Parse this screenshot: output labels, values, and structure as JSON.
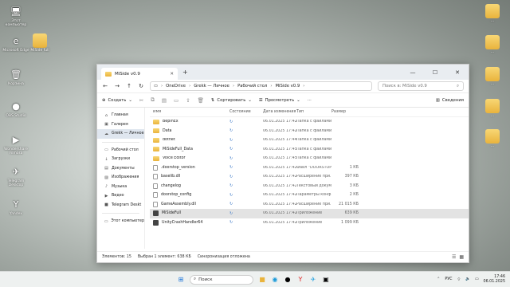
{
  "desktop": {
    "icons_left": [
      {
        "label": "Этот компьютер",
        "glyph": "🖥"
      },
      {
        "label": "Microsoft Edge",
        "glyph": "e"
      },
      {
        "label": "MiSide full",
        "glyph": ""
      },
      {
        "label": "Корзина",
        "glyph": "🗑"
      },
      {
        "label": "OBS Studio",
        "glyph": "●"
      },
      {
        "label": "Wondershare Filmora",
        "glyph": "▶"
      },
      {
        "label": "Telegram Desktop",
        "glyph": "✈"
      },
      {
        "label": "Yandex",
        "glyph": "Y"
      }
    ],
    "icons_right": [
      {
        "label": "..."
      },
      {
        "label": "..."
      },
      {
        "label": "..."
      },
      {
        "label": "..."
      },
      {
        "label": "..."
      }
    ]
  },
  "window": {
    "tab_title": "MiSide v0.9",
    "new_tab": "+",
    "controls": {
      "minimize": "—",
      "maximize": "☐",
      "close": "✕"
    },
    "address": [
      "OneDrive",
      "Grekk — Личное",
      "Рабочий стол",
      "MiSide v0.9"
    ],
    "search_placeholder": "Поиск в: MiSide v0.9",
    "toolbar": {
      "create": "Создать",
      "sort": "Сортировать",
      "view": "Просмотреть",
      "more": "···",
      "details": "Сведения"
    },
    "sidebar": [
      {
        "label": "Главная",
        "icon": "home-icon",
        "glyph": "⌂"
      },
      {
        "label": "Галерея",
        "icon": "gallery-icon",
        "glyph": "▣"
      },
      {
        "label": "Grekk — Личное",
        "icon": "cloud-icon",
        "glyph": "☁",
        "active": true
      },
      {
        "label": "Рабочий стол",
        "icon": "desktop-icon",
        "glyph": "▭"
      },
      {
        "label": "Загрузки",
        "icon": "download-icon",
        "glyph": "↓"
      },
      {
        "label": "Документы",
        "icon": "document-icon",
        "glyph": "▤"
      },
      {
        "label": "Изображения",
        "icon": "image-icon",
        "glyph": "▨"
      },
      {
        "label": "Музыка",
        "icon": "music-icon",
        "glyph": "♪"
      },
      {
        "label": "Видео",
        "icon": "video-icon",
        "glyph": "▶"
      },
      {
        "label": "Telegram Deskt",
        "icon": "folder-icon",
        "glyph": "■"
      },
      {
        "label": "Этот компьютер",
        "icon": "computer-icon",
        "glyph": "▭"
      }
    ],
    "columns": {
      "name": "Имя",
      "status": "Состояние",
      "date": "Дата изменения",
      "type": "Тип",
      "size": "Размер"
    },
    "files": [
      {
        "name": "BepInEx",
        "kind": "folder",
        "date": "06.01.2025 17:42",
        "type": "Папка с файлами",
        "size": ""
      },
      {
        "name": "Data",
        "kind": "folder",
        "date": "06.01.2025 17:42",
        "type": "Папка с файлами",
        "size": ""
      },
      {
        "name": "dotnet",
        "kind": "folder",
        "date": "06.01.2025 17:44",
        "type": "Папка с файлами",
        "size": ""
      },
      {
        "name": "MiSideFull_Data",
        "kind": "folder",
        "date": "06.01.2025 17:45",
        "type": "Папка с файлами",
        "size": ""
      },
      {
        "name": "Voice Editor",
        "kind": "folder",
        "date": "06.01.2025 17:45",
        "type": "Папка с файлами",
        "size": ""
      },
      {
        "name": ".doorstop_version",
        "kind": "file",
        "date": "06.01.2025 17:42",
        "type": "Файл \"DOORSTOP...",
        "size": "1 КБ"
      },
      {
        "name": "baselib.dll",
        "kind": "file",
        "date": "06.01.2025 17:42",
        "type": "Расширение при...",
        "size": "397 КБ"
      },
      {
        "name": "changelog",
        "kind": "file",
        "date": "06.01.2025 17:42",
        "type": "Текстовый докум...",
        "size": "3 КБ"
      },
      {
        "name": "doorstop_config",
        "kind": "file",
        "date": "06.01.2025 17:42",
        "type": "Параметры конф...",
        "size": "2 КБ"
      },
      {
        "name": "GameAssembly.dll",
        "kind": "file",
        "date": "06.01.2025 17:42",
        "type": "Расширение при...",
        "size": "21 015 КБ"
      },
      {
        "name": "MiSideFull",
        "kind": "app",
        "date": "06.01.2025 17:42",
        "type": "Приложение",
        "size": "639 КБ",
        "selected": true
      },
      {
        "name": "UnityCrashHandler64",
        "kind": "app",
        "date": "06.01.2025 17:42",
        "type": "Приложение",
        "size": "1 099 КБ"
      }
    ],
    "status": {
      "count": "Элементов: 15",
      "selected": "Выбран 1 элемент: 638 КБ",
      "sync": "Синхронизация отложена"
    }
  },
  "taskbar": {
    "weather": "",
    "search_placeholder": "Поиск",
    "language": "РУС",
    "time": "17:46",
    "date": "06.01.2025"
  }
}
